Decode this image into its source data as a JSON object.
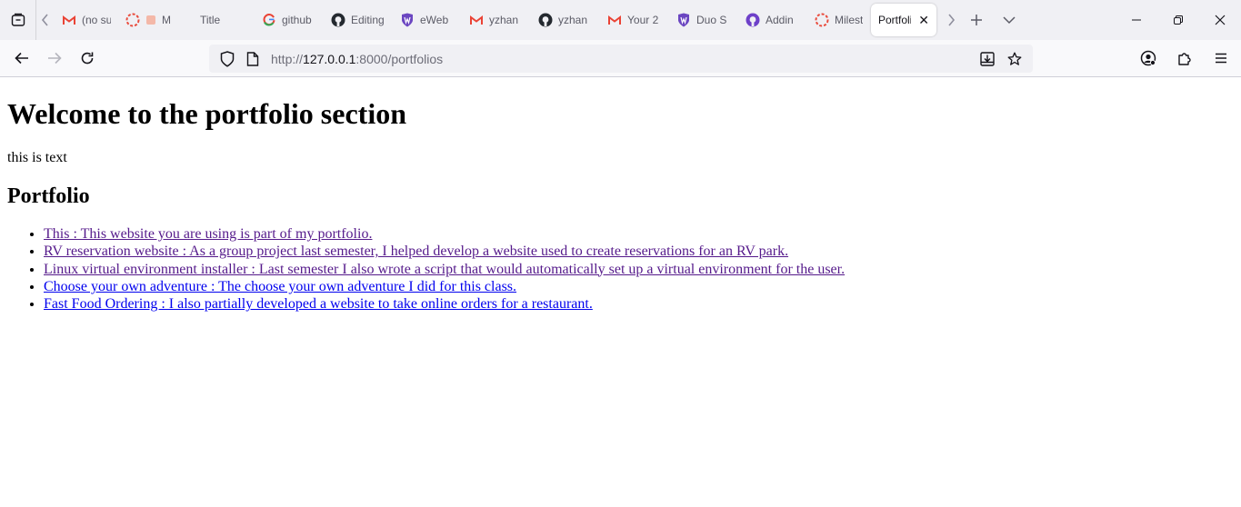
{
  "browser": {
    "tabs": [
      {
        "label": "(no su",
        "icon": "gmail-icon"
      },
      {
        "label": "M",
        "icon": "sync-icon"
      },
      {
        "label": "Title",
        "icon": "none"
      },
      {
        "label": "github",
        "icon": "google-icon"
      },
      {
        "label": "Editing",
        "icon": "github-icon"
      },
      {
        "label": "eWeb",
        "icon": "shield-icon"
      },
      {
        "label": "yzhan",
        "icon": "gmail-icon"
      },
      {
        "label": "yzhan",
        "icon": "github-icon"
      },
      {
        "label": "Your 2",
        "icon": "gmail-icon"
      },
      {
        "label": "Duo S",
        "icon": "shield-icon"
      },
      {
        "label": "Addin",
        "icon": "github-icon"
      },
      {
        "label": "Milest",
        "icon": "sync-icon"
      },
      {
        "label": "Portfoli",
        "icon": "none",
        "active": true
      }
    ],
    "url": {
      "scheme": "http://",
      "host": "127.0.0.1",
      "rest": ":8000/portfolios"
    },
    "colors": {
      "gmail_red": "#ea4335",
      "shield_purple": "#6b46c1",
      "sync_red": "#e94b3c",
      "visited_link": "#551a8b",
      "unvisited_link": "#0000ee"
    }
  },
  "page": {
    "heading": "Welcome to the portfolio section",
    "intro": "this is text",
    "section_title": "Portfolio",
    "items": [
      {
        "text": "This : This website you are using is part of my portfolio.",
        "visited": true
      },
      {
        "text": "RV reservation website : As a group project last semester, I helped develop a website used to create reservations for an RV park.",
        "visited": true
      },
      {
        "text": "Linux virtual environment installer : Last semester I also wrote a script that would automatically set up a virtual environment for the user.",
        "visited": true
      },
      {
        "text": "Choose your own adventure : The choose your own adventure I did for this class.",
        "visited": false
      },
      {
        "text": "Fast Food Ordering : I also partially developed a website to take online orders for a restaurant.",
        "visited": false
      }
    ]
  }
}
